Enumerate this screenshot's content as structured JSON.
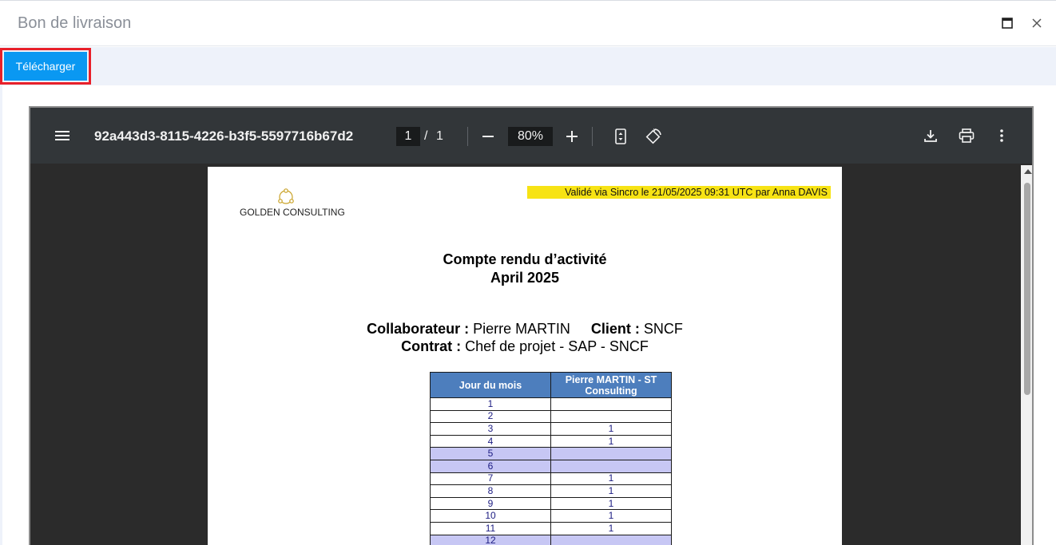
{
  "dialog": {
    "title": "Bon de livraison"
  },
  "toolbar": {
    "download_label": "Télécharger"
  },
  "viewer": {
    "doc_id": "92a443d3-8115-4226-b3f5-5597716b67d2",
    "current_page": "1",
    "page_sep": "/",
    "total_pages": "1",
    "zoom": "80%"
  },
  "document": {
    "logo_text": "GOLDEN CONSULTING",
    "validation": "Validé via Sincro le 21/05/2025 09:31 UTC par Anna DAVIS",
    "heading": "Compte rendu d’activité",
    "period": "April 2025",
    "collaborator_label": "Collaborateur :",
    "collaborator": "Pierre MARTIN",
    "client_label": "Client :",
    "client": "SNCF",
    "contract_label": "Contrat :",
    "contract": "Chef de projet - SAP - SNCF",
    "table": {
      "headers": [
        "Jour du mois",
        "Pierre MARTIN - ST Consulting"
      ],
      "rows": [
        {
          "day": "1",
          "value": "",
          "weekend": false
        },
        {
          "day": "2",
          "value": "",
          "weekend": false
        },
        {
          "day": "3",
          "value": "1",
          "weekend": false
        },
        {
          "day": "4",
          "value": "1",
          "weekend": false
        },
        {
          "day": "5",
          "value": "",
          "weekend": true
        },
        {
          "day": "6",
          "value": "",
          "weekend": true
        },
        {
          "day": "7",
          "value": "1",
          "weekend": false
        },
        {
          "day": "8",
          "value": "1",
          "weekend": false
        },
        {
          "day": "9",
          "value": "1",
          "weekend": false
        },
        {
          "day": "10",
          "value": "1",
          "weekend": false
        },
        {
          "day": "11",
          "value": "1",
          "weekend": false
        },
        {
          "day": "12",
          "value": "",
          "weekend": true
        }
      ]
    }
  },
  "colors": {
    "download_button": "#0a98f2",
    "highlight_border": "#e8202a",
    "validation_highlight": "#f7e314",
    "table_header": "#4d7ebd",
    "weekend_row": "#c7c7f4"
  },
  "icons": [
    "maximize-icon",
    "close-icon",
    "menu-icon",
    "zoom-out-icon",
    "zoom-in-icon",
    "fit-page-icon",
    "rotate-icon",
    "download-icon",
    "print-icon",
    "more-options-icon",
    "logo-icon"
  ]
}
